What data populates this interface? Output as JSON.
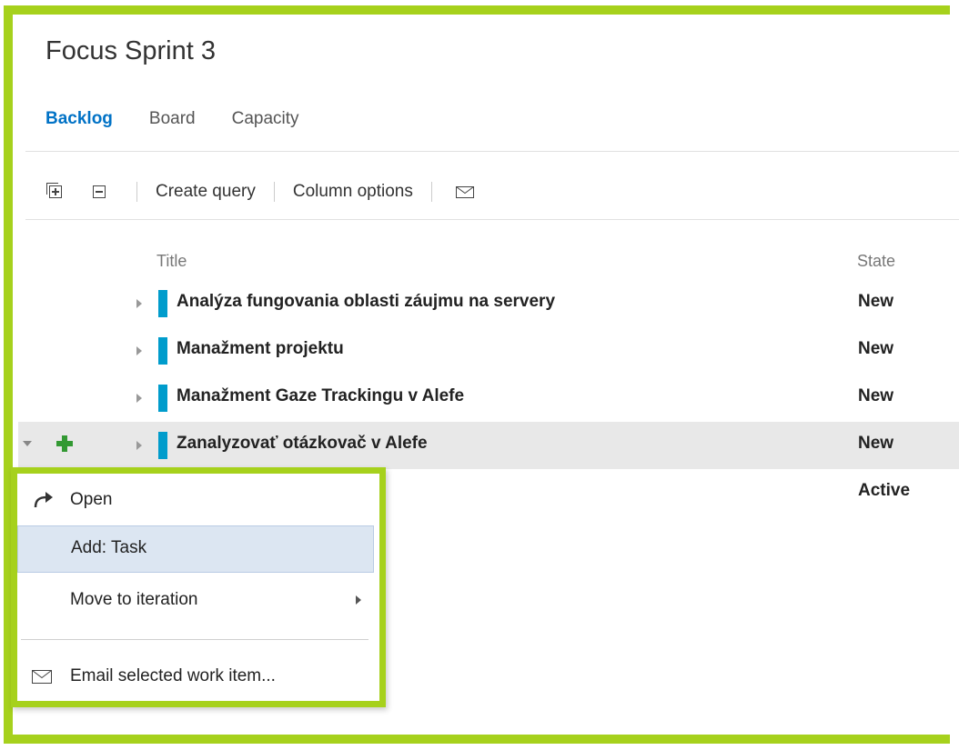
{
  "page": {
    "title": "Focus Sprint 3",
    "accent_color": "#0072c6",
    "highlight_frame_color": "#a6d11c"
  },
  "tabs": [
    {
      "label": "Backlog",
      "active": true
    },
    {
      "label": "Board",
      "active": false
    },
    {
      "label": "Capacity",
      "active": false
    }
  ],
  "toolbar": {
    "expand_all_icon": "expand-all-icon",
    "collapse_all_icon": "collapse-all-icon",
    "create_query_label": "Create query",
    "column_options_label": "Column options",
    "email_icon": "mail-icon"
  },
  "grid": {
    "columns": {
      "title": "Title",
      "state": "State"
    },
    "rows": [
      {
        "title": "Analýza fungovania oblasti záujmu na servery",
        "state": "New"
      },
      {
        "title": "Manažment projektu",
        "state": "New"
      },
      {
        "title": "Manažment Gaze Trackingu v Alefe",
        "state": "New"
      },
      {
        "title": "Zanalyzovať otázkovač v Alefe",
        "state": "New",
        "selected": true
      },
      {
        "title": "",
        "state": "Active"
      }
    ],
    "row_color": "#009ccc"
  },
  "context_menu": {
    "open_label": "Open",
    "add_task_label": "Add: Task",
    "move_to_iteration_label": "Move to iteration",
    "email_label": "Email selected work item..."
  }
}
